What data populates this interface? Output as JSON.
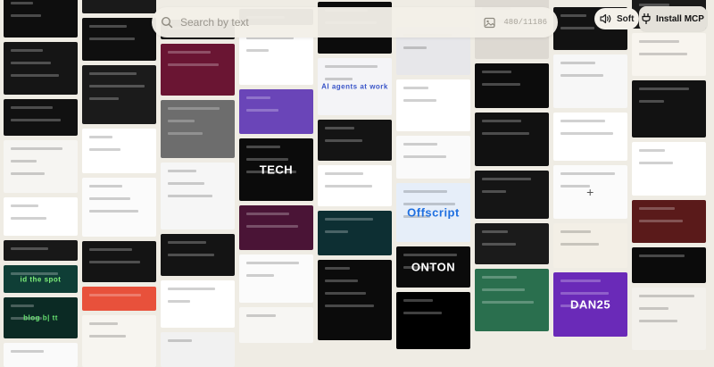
{
  "search": {
    "placeholder": "Search by text",
    "count": "480/11186"
  },
  "controls": {
    "soft_label": "Soft",
    "install_label": "Install MCP"
  },
  "gallery": [
    [
      {
        "bg": "#0e0e0e",
        "h": 54,
        "light": false
      },
      {
        "bg": "#151515",
        "h": 66,
        "light": false
      },
      {
        "bg": "#111111",
        "h": 46,
        "light": false
      },
      {
        "bg": "#f6f5f2",
        "h": 66,
        "light": true
      },
      {
        "bg": "#ffffff",
        "h": 48,
        "light": true
      },
      {
        "bg": "#181818",
        "h": 26,
        "light": false
      },
      {
        "bg": "#0f3e36",
        "h": 34,
        "light": false,
        "text": "id the spot",
        "tc": "#7ef07a"
      },
      {
        "bg": "#0b2a24",
        "h": 52,
        "light": false,
        "text": "blog   b|   tt",
        "tc": "#66e070"
      },
      {
        "bg": "#fafafa",
        "h": 30,
        "light": true
      }
    ],
    [
      {
        "bg": "#1a1a1a",
        "h": 36,
        "light": false
      },
      {
        "bg": "#0f0f0f",
        "h": 50,
        "light": false
      },
      {
        "bg": "#1b1b1b",
        "h": 68,
        "light": false
      },
      {
        "bg": "#ffffff",
        "h": 52,
        "light": true
      },
      {
        "bg": "#fbfbfb",
        "h": 68,
        "light": true
      },
      {
        "bg": "#141414",
        "h": 48,
        "light": false
      },
      {
        "bg": "#e8513b",
        "h": 28,
        "light": false
      },
      {
        "bg": "#f7f5f0",
        "h": 60,
        "light": true
      }
    ],
    [
      {
        "bg": "#141414",
        "h": 22,
        "light": false
      },
      {
        "bg": "#6a1533",
        "h": 60,
        "light": false
      },
      {
        "bg": "#6d6d6d",
        "h": 66,
        "light": false
      },
      {
        "bg": "#f6f6f6",
        "h": 76,
        "light": true
      },
      {
        "bg": "#141414",
        "h": 48,
        "light": false
      },
      {
        "bg": "#ffffff",
        "h": 54,
        "light": true
      },
      {
        "bg": "#f1f1f1",
        "h": 40,
        "light": true
      }
    ],
    [
      {
        "bg": "#111111",
        "h": 18,
        "light": false
      },
      {
        "bg": "#ffffff",
        "h": 62,
        "light": true
      },
      {
        "bg": "#6a45b8",
        "h": 50,
        "light": false
      },
      {
        "bg": "#0b0b0b",
        "h": 70,
        "light": false,
        "text": "TECH",
        "tc": "#ffffff"
      },
      {
        "bg": "#4a1436",
        "h": 50,
        "light": false
      },
      {
        "bg": "#fbfbfb",
        "h": 54,
        "light": true
      },
      {
        "bg": "#f7f6f3",
        "h": 40,
        "light": true
      }
    ],
    [
      {
        "bg": "#0c0c0c",
        "h": 58,
        "light": false
      },
      {
        "bg": "#f4f4f7",
        "h": 64,
        "light": true,
        "text": "AI agents at work",
        "tc": "#3a55c8"
      },
      {
        "bg": "#141414",
        "h": 46,
        "light": false
      },
      {
        "bg": "#ffffff",
        "h": 46,
        "light": true
      },
      {
        "bg": "#0d2f33",
        "h": 50,
        "light": false
      },
      {
        "bg": "#0b0b0b",
        "h": 90,
        "light": false
      }
    ],
    [
      {
        "bg": "#e7e7ea",
        "h": 54,
        "light": true
      },
      {
        "bg": "#ffffff",
        "h": 58,
        "light": true
      },
      {
        "bg": "#fafafa",
        "h": 48,
        "light": true
      },
      {
        "bg": "#e6eef9",
        "h": 66,
        "light": true,
        "text": "Offscript",
        "tc": "#1f6fe0"
      },
      {
        "bg": "#0b0b0b",
        "h": 46,
        "light": false,
        "text": "ONTON",
        "tc": "#ffffff"
      },
      {
        "bg": "#000000",
        "h": 64,
        "light": false
      }
    ],
    [
      {
        "bg": "#ddd9d2",
        "h": 80,
        "light": true
      },
      {
        "bg": "#0c0c0c",
        "h": 50,
        "light": false
      },
      {
        "bg": "#111111",
        "h": 60,
        "light": false
      },
      {
        "bg": "#151515",
        "h": 54,
        "light": false
      },
      {
        "bg": "#1b1b1b",
        "h": 46,
        "light": false
      },
      {
        "bg": "#2a6f4e",
        "h": 70,
        "light": false
      }
    ],
    [
      {
        "bg": "#121212",
        "h": 48,
        "light": false
      },
      {
        "bg": "#f7f7f7",
        "h": 60,
        "light": true
      },
      {
        "bg": "#ffffff",
        "h": 54,
        "light": true
      },
      {
        "bg": "#fbfbfb",
        "h": 60,
        "light": true,
        "plus": true
      },
      {
        "bg": "#f3efe6",
        "h": 50,
        "light": true
      },
      {
        "bg": "#6a2ab8",
        "h": 72,
        "light": false,
        "text": "DAN25",
        "tc": "#ffffff"
      }
    ],
    [
      {
        "bg": "#1a1a1a",
        "h": 36,
        "light": false
      },
      {
        "bg": "#f8f5ef",
        "h": 48,
        "light": true
      },
      {
        "bg": "#121212",
        "h": 64,
        "light": false
      },
      {
        "bg": "#ffffff",
        "h": 60,
        "light": true
      },
      {
        "bg": "#5a1a1a",
        "h": 48,
        "light": false
      },
      {
        "bg": "#0b0b0b",
        "h": 40,
        "light": false
      },
      {
        "bg": "#f3f1ec",
        "h": 70,
        "light": true
      }
    ]
  ]
}
